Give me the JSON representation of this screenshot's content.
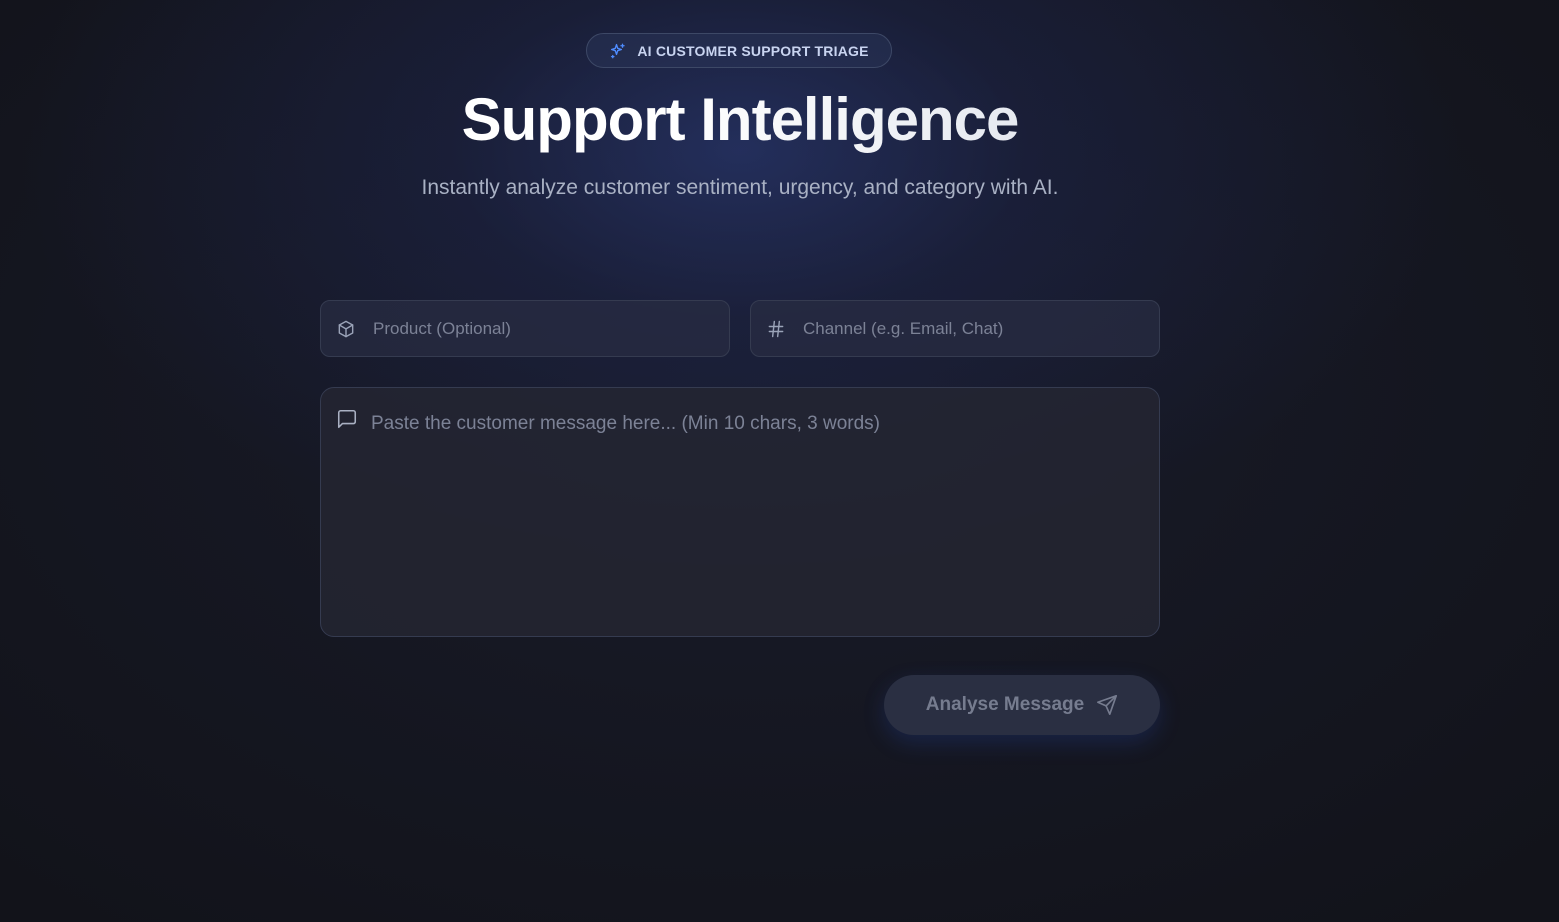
{
  "badge": {
    "icon": "sparkles-icon",
    "label": "AI CUSTOMER SUPPORT TRIAGE",
    "icon_color": "#4f8cff"
  },
  "header": {
    "title": "Support Intelligence",
    "subtitle": "Instantly analyze customer sentiment, urgency, and category with AI."
  },
  "form": {
    "product": {
      "icon": "package-icon",
      "value": "",
      "placeholder": "Product (Optional)"
    },
    "channel": {
      "icon": "hash-icon",
      "value": "",
      "placeholder": "Channel (e.g. Email, Chat)"
    },
    "message": {
      "icon": "message-square-icon",
      "value": "",
      "placeholder": "Paste the customer message here... (Min 10 chars, 3 words)"
    },
    "submit": {
      "label": "Analyse Message",
      "icon": "send-icon",
      "disabled": true
    }
  },
  "colors": {
    "background": "#12131a",
    "accent": "#4f8cff",
    "field_border": "#353b50"
  }
}
